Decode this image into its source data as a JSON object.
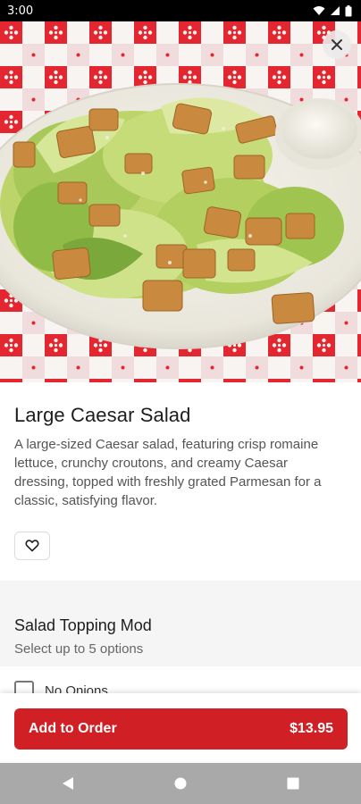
{
  "status_bar": {
    "time": "3:00",
    "icons": [
      "wifi-icon",
      "cell-signal-icon",
      "battery-icon"
    ]
  },
  "hero": {
    "image_subject": "caesar-salad-photo",
    "close_icon": "close-icon"
  },
  "item": {
    "title": "Large Caesar Salad",
    "description": "A large-sized Caesar salad, featuring crisp romaine lettuce, crunchy croutons, and creamy Caesar dressing, topped with freshly grated Parmesan for a classic, satisfying flavor.",
    "favorite_icon": "heart-outline-icon"
  },
  "modifier_group": {
    "title": "Salad Topping Mod",
    "subtitle": "Select up to 5 options",
    "options": [
      {
        "label": "No Onions",
        "checked": false
      }
    ]
  },
  "footer": {
    "add_label": "Add to Order",
    "price": "$13.95"
  },
  "colors": {
    "accent_red": "#d11f26",
    "tablecloth_red": "#e3262f"
  },
  "nav_bar": {
    "buttons": [
      "back-icon",
      "home-icon",
      "recents-icon"
    ]
  }
}
